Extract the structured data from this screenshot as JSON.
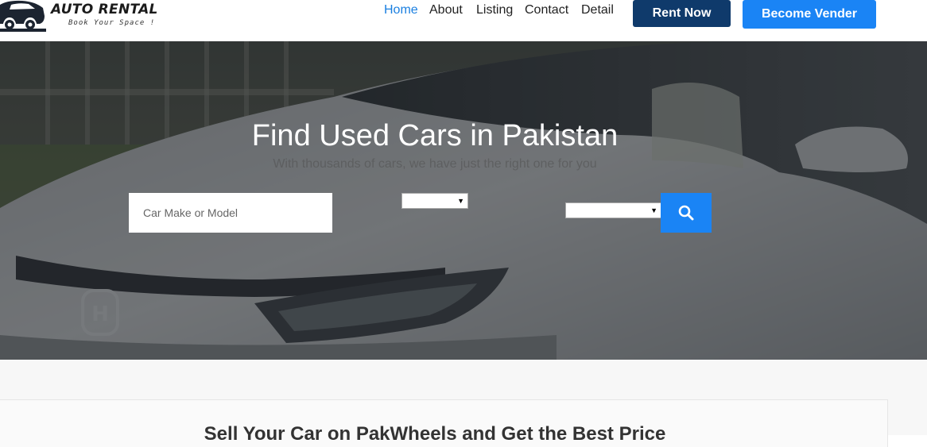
{
  "header": {
    "logo": {
      "title": "AUTO RENTAL",
      "tagline": "Book Your Space !"
    },
    "nav": [
      {
        "label": "Home",
        "active": true
      },
      {
        "label": "About",
        "active": false
      },
      {
        "label": "Listing",
        "active": false
      },
      {
        "label": "Contact",
        "active": false
      },
      {
        "label": "Detail",
        "active": false
      }
    ],
    "rent_now_label": "Rent Now",
    "become_vender_label": "Become Vender"
  },
  "hero": {
    "title": "Find Used Cars in Pakistan",
    "subtitle": "With thousands of cars, we have just the right one for you",
    "search": {
      "placeholder": "Car Make or Model",
      "value": ""
    },
    "select_1_value": "",
    "select_2_value": "",
    "search_button_icon": "search-icon"
  },
  "sell_section": {
    "title": "Sell Your Car on PakWheels and Get the Best Price"
  },
  "colors": {
    "nav_active": "#1a7fe0",
    "rent_now_bg": "#0f3a6b",
    "primary_blue": "#1a84f5",
    "hero_overlay": "#2b2e33"
  }
}
